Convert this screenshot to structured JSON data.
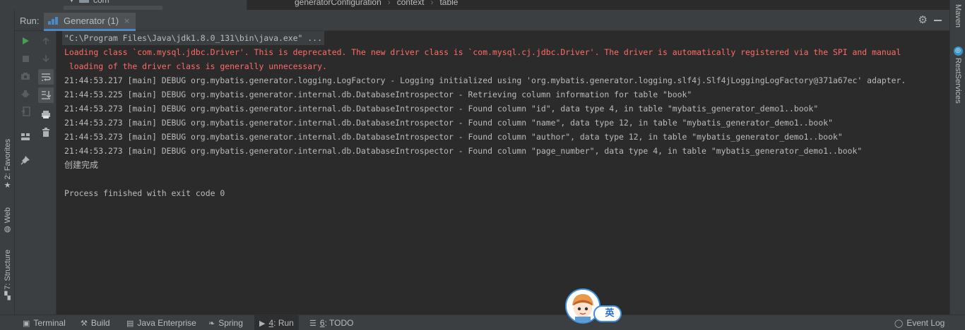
{
  "top": {
    "tree_fragment": "com",
    "breadcrumb": [
      "generatorConfiguration",
      "context",
      "table"
    ]
  },
  "run_window": {
    "label": "Run:",
    "tab_title": "Generator (1)",
    "close_glyph": "×"
  },
  "console": {
    "lines": [
      "\"C:\\Program Files\\Java\\jdk1.8.0_131\\bin\\java.exe\" ...",
      "Loading class `com.mysql.jdbc.Driver'. This is deprecated. The new driver class is `com.mysql.cj.jdbc.Driver'. The driver is automatically registered via the SPI and manual",
      " loading of the driver class is generally unnecessary.",
      "21:44:53.217 [main] DEBUG org.mybatis.generator.logging.LogFactory - Logging initialized using 'org.mybatis.generator.logging.slf4j.Slf4jLoggingLogFactory@371a67ec' adapter.",
      "21:44:53.225 [main] DEBUG org.mybatis.generator.internal.db.DatabaseIntrospector - Retrieving column information for table \"book\"",
      "21:44:53.273 [main] DEBUG org.mybatis.generator.internal.db.DatabaseIntrospector - Found column \"id\", data type 4, in table \"mybatis_generator_demo1..book\"",
      "21:44:53.273 [main] DEBUG org.mybatis.generator.internal.db.DatabaseIntrospector - Found column \"name\", data type 12, in table \"mybatis_generator_demo1..book\"",
      "21:44:53.273 [main] DEBUG org.mybatis.generator.internal.db.DatabaseIntrospector - Found column \"author\", data type 12, in table \"mybatis_generator_demo1..book\"",
      "21:44:53.273 [main] DEBUG org.mybatis.generator.internal.db.DatabaseIntrospector - Found column \"page_number\", data type 4, in table \"mybatis_generator_demo1..book\"",
      "创建完成",
      "",
      "Process finished with exit code 0"
    ]
  },
  "left_strip": {
    "favorites": "2: Favorites",
    "web": "Web",
    "structure": "7: Structure"
  },
  "right_strip": {
    "maven": "Maven",
    "rest_services": "RestServices"
  },
  "bottom_bar": {
    "terminal": "Terminal",
    "build": "Build",
    "java_enterprise": "Java Enterprise",
    "spring": "Spring",
    "run_num": "4",
    "run_label": ": Run",
    "todo_num": "6",
    "todo_label": ": TODO",
    "event_log": "Event Log"
  },
  "ime": {
    "mode": "英"
  },
  "colors": {
    "error_text": "#ff6b68",
    "accent": "#4a88c7",
    "run_green": "#499c54",
    "panel_bg": "#3c3f41",
    "console_bg": "#2b2b2b"
  },
  "icons": [
    "run-icon",
    "stop-icon",
    "screenshot-icon",
    "debug-icon",
    "exit-icon",
    "layout-icon",
    "pin-icon",
    "scroll-up-icon",
    "scroll-down-icon",
    "soft-wrap-icon",
    "scroll-to-end-icon",
    "print-icon",
    "clear-icon",
    "gear-icon",
    "minimize-icon"
  ]
}
